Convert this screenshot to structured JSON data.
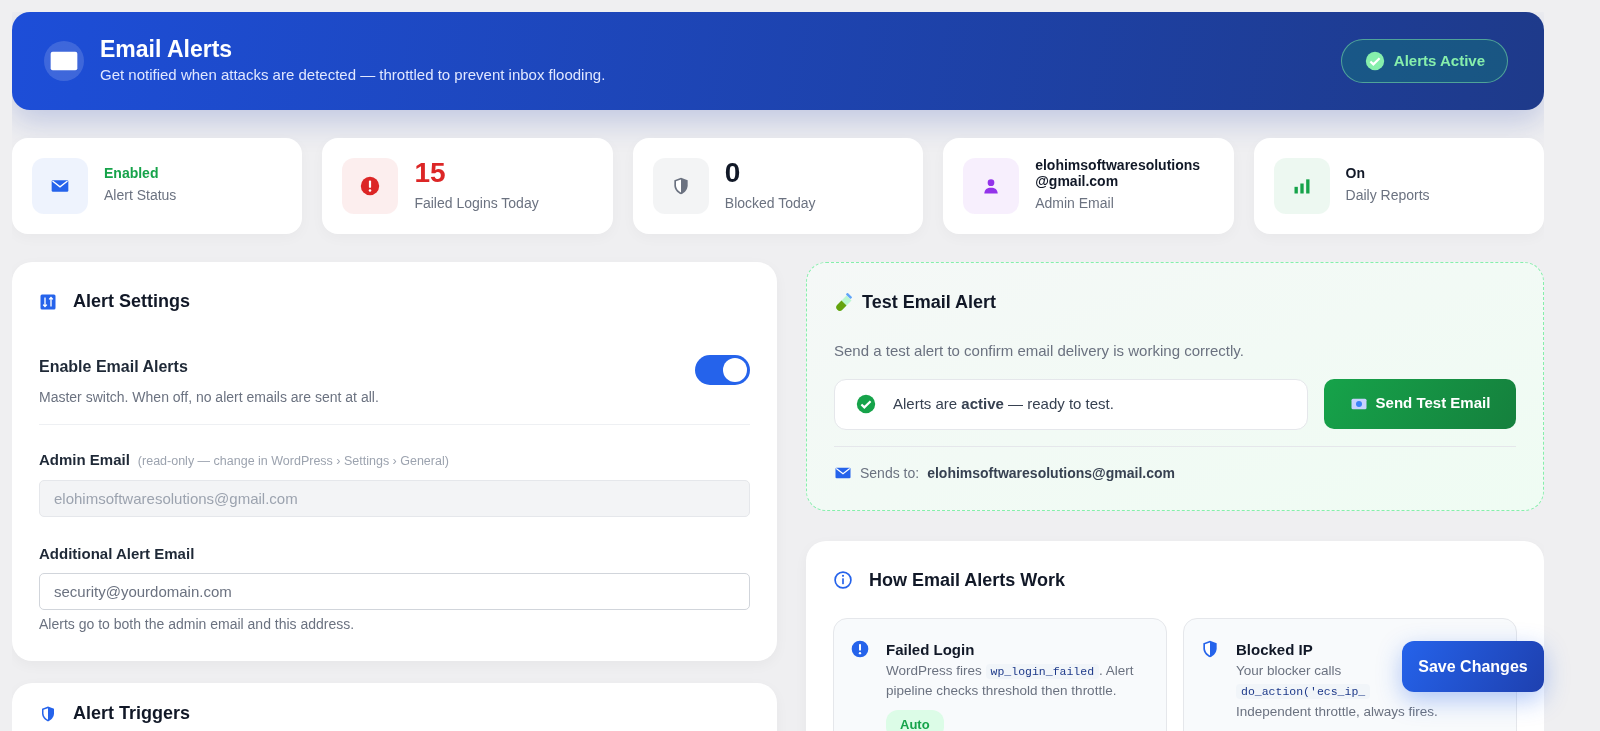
{
  "header": {
    "title": "Email Alerts",
    "subtitle": "Get notified when attacks are detected — throttled to prevent inbox flooding.",
    "status_badge": {
      "label": "Alerts Active",
      "active": true
    }
  },
  "stats": [
    {
      "kind": "text",
      "color": "#2563eb",
      "highlight": true,
      "value": "Enabled",
      "label": "Alert Status"
    },
    {
      "kind": "count",
      "color": "#dc2626",
      "highlight": true,
      "value": "15",
      "label": "Failed Logins Today"
    },
    {
      "kind": "count",
      "color": "#6b7280",
      "highlight": false,
      "value": "0",
      "label": "Blocked Today"
    },
    {
      "kind": "text",
      "color": "#9333ea",
      "highlight": false,
      "value": "elohimsoftwaresolutions@gmail.com",
      "label": "Admin Email"
    },
    {
      "kind": "text",
      "color": "#16a34a",
      "highlight": false,
      "value": "On",
      "label": "Daily Reports"
    }
  ],
  "alert_settings": {
    "title": "Alert Settings",
    "enable": {
      "label": "Enable Email Alerts",
      "description": "Master switch. When off, no alert emails are sent at all.",
      "on": true
    },
    "admin_email": {
      "label": "Admin Email",
      "hint": "(read-only — change in WordPress › Settings › General)",
      "value": "elohimsoftwaresolutions@gmail.com",
      "disabled": true
    },
    "additional_email": {
      "label": "Additional Alert Email",
      "placeholder": "security@yourdomain.com",
      "help": "Alerts go to both the admin email and this address."
    }
  },
  "alert_triggers": {
    "title": "Alert Triggers"
  },
  "test_alert": {
    "title": "Test Email Alert",
    "description": "Send a test alert to confirm email delivery is working correctly.",
    "status": {
      "ready": true,
      "text": "Alerts are **active** — ready to test."
    },
    "button": "Send Test Email",
    "sends_to_label": "Sends to:",
    "sends_to": "elohimsoftwaresolutions@gmail.com"
  },
  "how_it_works": {
    "title": "How Email Alerts Work",
    "items": [
      {
        "title": "Failed Login",
        "parts": [
          {
            "kind": "text",
            "t": "WordPress fires "
          },
          {
            "kind": "code",
            "t": "wp_login_failed"
          },
          {
            "kind": "text",
            "t": ". Alert pipeline checks threshold then throttle."
          }
        ],
        "badge": "Auto"
      },
      {
        "title": "Blocked IP",
        "parts": [
          {
            "kind": "text",
            "t": "Your blocker calls"
          },
          {
            "kind": "code",
            "t": "do_action('ecs_ip_"
          },
          {
            "kind": "text",
            "t": "Independent throttle, always fires."
          }
        ]
      }
    ]
  },
  "save_button": "Save Changes"
}
